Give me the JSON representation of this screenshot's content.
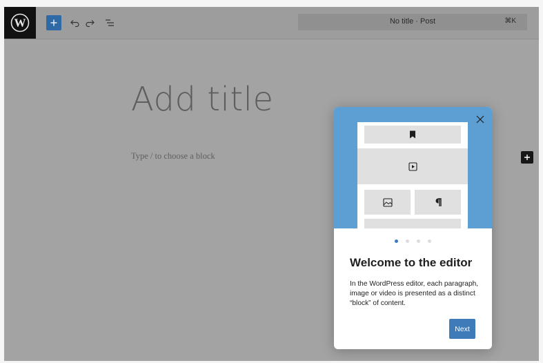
{
  "header": {
    "logo_icon": "wordpress-icon",
    "toolbar": [
      {
        "name": "add-block-button",
        "icon": "plus-icon"
      },
      {
        "name": "undo-button",
        "icon": "undo-icon"
      },
      {
        "name": "redo-button",
        "icon": "redo-icon"
      },
      {
        "name": "document-overview-button",
        "icon": "list-view-icon"
      }
    ],
    "command_bar": {
      "title": "No title · Post",
      "shortcut": "⌘K"
    }
  },
  "editor": {
    "title_placeholder": "Add title",
    "block_placeholder": "Type / to choose a block"
  },
  "welcome_guide": {
    "hero_color": "#5d9ed3",
    "page_count": 4,
    "current_page": 1,
    "heading": "Welcome to the editor",
    "body": "In the WordPress editor, each paragraph, image or video is presented as a distinct “block” of content.",
    "next_label": "Next"
  },
  "colors": {
    "accent": "#3f7ab9",
    "overlay": "#a3a3a3",
    "logo_bg": "#111111"
  }
}
